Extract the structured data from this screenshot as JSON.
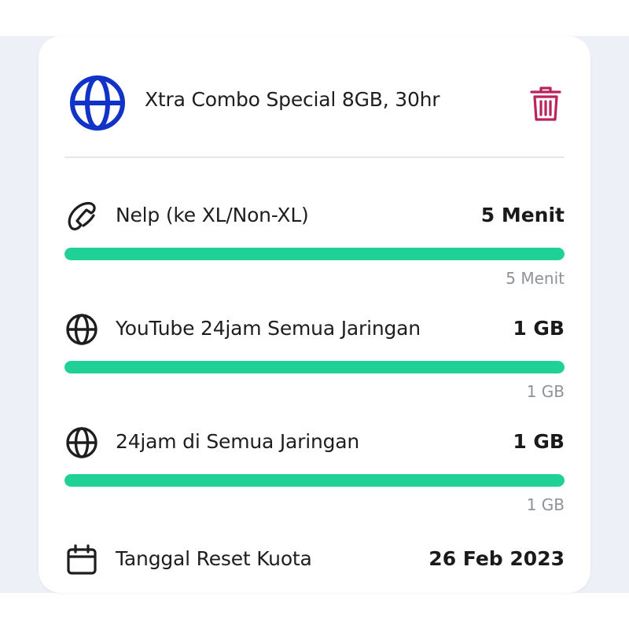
{
  "package": {
    "title": "Xtra Combo Special 8GB, 30hr",
    "icon": "globe-icon",
    "icon_color": "#1233c7",
    "delete_icon": "trash-icon",
    "delete_color": "#b9225a"
  },
  "quotas": [
    {
      "icon": "phone-icon",
      "label": "Nelp (ke XL/Non-XL)",
      "value": "5 Menit",
      "remaining": "5 Menit",
      "remaining_fraction": 1.0
    },
    {
      "icon": "globe-icon",
      "label": "YouTube 24jam Semua Jaringan",
      "value": "1 GB",
      "remaining": "1 GB",
      "remaining_fraction": 1.0
    },
    {
      "icon": "globe-icon",
      "label": "24jam di Semua Jaringan",
      "value": "1 GB",
      "remaining": "1 GB",
      "remaining_fraction": 1.0
    }
  ],
  "reset": {
    "icon": "calendar-icon",
    "label": "Tanggal Reset Kuota",
    "value": "26 Feb 2023"
  },
  "colors": {
    "progress": "#1fd196",
    "text": "#1e1e1e",
    "muted": "#8d929b"
  }
}
